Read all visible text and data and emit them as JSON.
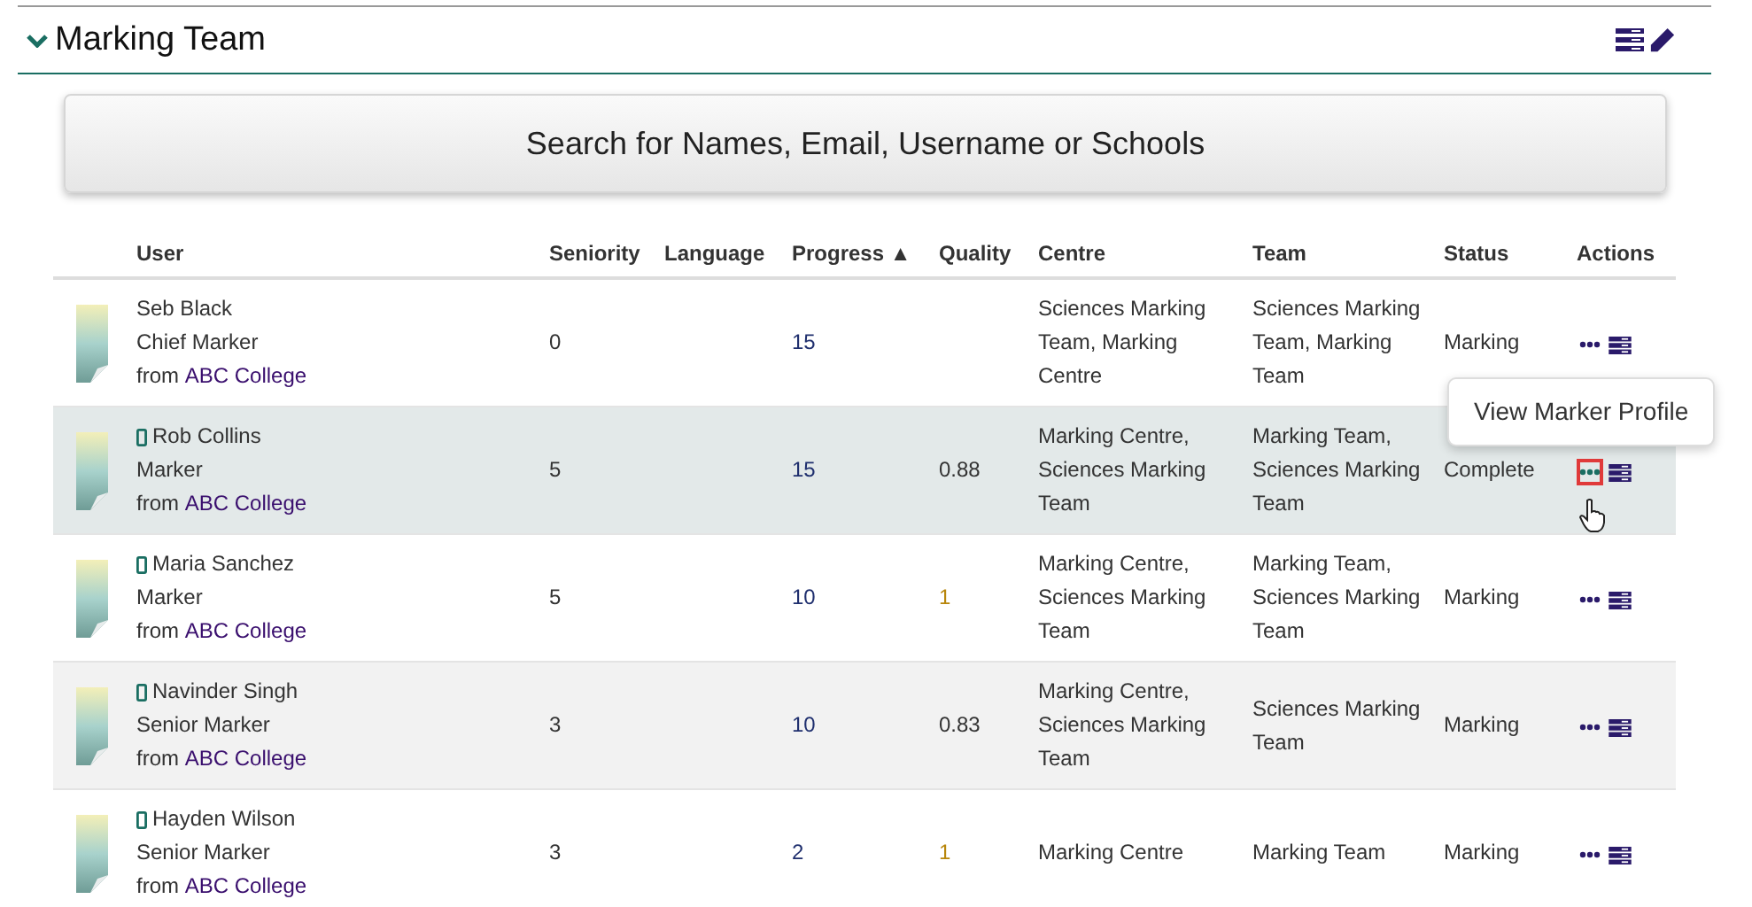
{
  "section": {
    "title": "Marking Team",
    "expanded": true
  },
  "search_button": "Search for Names, Email, Username or Schools",
  "table": {
    "columns": [
      "User",
      "Seniority",
      "Language",
      "Progress ▲",
      "Quality",
      "Centre",
      "Team",
      "Status",
      "Actions"
    ],
    "rows": [
      {
        "mobile": false,
        "name": "Seb Black",
        "role": "Chief Marker",
        "from": "from",
        "school": "ABC College",
        "seniority": "0",
        "progress": "15",
        "centre": "Sciences Marking Team, Marking Centre",
        "team": "Sciences Marking Team, Marking Team",
        "status": "Marking",
        "hovered": false
      },
      {
        "mobile": true,
        "name": "Rob Collins",
        "role": "Marker",
        "from": "from",
        "school": "ABC College",
        "seniority": "5",
        "progress": "15",
        "quality": {
          "text": "0.88",
          "color": "#333333"
        },
        "centre": "Marking Centre, Sciences Marking Team",
        "team": "Marking Team, Sciences Marking Team",
        "status": "Complete",
        "hovered": true,
        "tooltip": "View Marker Profile"
      },
      {
        "mobile": true,
        "name": "Maria Sanchez",
        "role": "Marker",
        "from": "from",
        "school": "ABC College",
        "seniority": "5",
        "progress": "10",
        "quality": {
          "text": "1",
          "color": "#b8860b"
        },
        "centre": "Marking Centre, Sciences Marking Team",
        "team": "Marking Team, Sciences Marking Team",
        "status": "Marking",
        "hovered": false
      },
      {
        "mobile": true,
        "name": "Navinder Singh",
        "role": "Senior Marker",
        "from": "from",
        "school": "ABC College",
        "seniority": "3",
        "progress": "10",
        "quality": {
          "text": "0.83",
          "color": "#333333"
        },
        "centre": "Marking Centre, Sciences Marking Team",
        "team": "Sciences Marking Team",
        "status": "Marking",
        "hovered": false
      },
      {
        "mobile": true,
        "name": "Hayden Wilson",
        "role": "Senior Marker",
        "from": "from",
        "school": "ABC College",
        "seniority": "3",
        "progress": "2",
        "quality": {
          "text": "1",
          "color": "#b8860b"
        },
        "centre": "Marking Centre",
        "team": "Marking Team",
        "status": "Marking",
        "hovered": false
      }
    ]
  }
}
